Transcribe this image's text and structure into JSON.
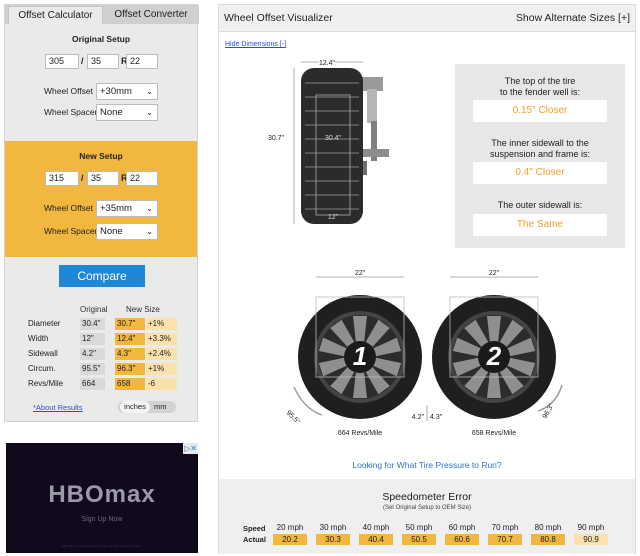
{
  "calculator": {
    "tabs": [
      "Offset Calculator",
      "Offset Converter"
    ],
    "original": {
      "title": "Original Setup",
      "width": "305",
      "sep1": "/",
      "ratio": "35",
      "sep2": "R",
      "rim": "22",
      "offset_label": "Wheel Offset",
      "offset_value": "+30mm",
      "spacer_label": "Wheel Spacer",
      "spacer_value": "None"
    },
    "new": {
      "title": "New Setup",
      "width": "315",
      "sep1": "/",
      "ratio": "35",
      "sep2": "R",
      "rim": "22",
      "offset_label": "Wheel Offset",
      "offset_value": "+35mm",
      "spacer_label": "Wheel Spacer",
      "spacer_value": "None"
    },
    "compare_label": "Compare",
    "comparison": {
      "headers": [
        "Original",
        "New Size"
      ],
      "rows": [
        {
          "label": "Diameter",
          "original": "30.4\"",
          "new": "30.7\"",
          "diff": "+1%"
        },
        {
          "label": "Width",
          "original": "12\"",
          "new": "12.4\"",
          "diff": "+3.3%"
        },
        {
          "label": "Sidewall",
          "original": "4.2\"",
          "new": "4.3\"",
          "diff": "+2.4%"
        },
        {
          "label": "Circum.",
          "original": "95.5\"",
          "new": "96.3\"",
          "diff": "+1%"
        },
        {
          "label": "Revs/Mile",
          "original": "664",
          "new": "658",
          "diff": "-6"
        }
      ]
    },
    "about_link": "*About Results",
    "units": [
      "inches",
      "mm"
    ]
  },
  "ad": {
    "choices": "▷✕",
    "brand": "HBOmax",
    "cta": "Sign Up Now",
    "fine_print": "HBO Max is only accessible in the US and certain territories."
  },
  "visualizer": {
    "title": "Wheel Offset Visualizer",
    "alt_sizes": "Show Alternate Sizes [+]",
    "hide_dimensions": "Hide Dimensions [-]",
    "tire_dims": {
      "width": "12.4\"",
      "height": "30.7\"",
      "inner": "30.4\"",
      "bottom": "12\""
    },
    "results": [
      {
        "question": "The top of the tire\nto the fender well is:",
        "answer": "0.15\" Closer"
      },
      {
        "question": "The inner sidewall to the\nsuspension and frame is:",
        "answer": "0.4\" Closer"
      },
      {
        "question": "The outer sidewall is:",
        "answer": "The Same"
      }
    ],
    "wheels": [
      {
        "num": "1",
        "width": "22\"",
        "circ": "95.5\"",
        "sidewall": "4.2\"",
        "revs": "664 Revs/Mile"
      },
      {
        "num": "2",
        "width": "22\"",
        "circ": "96.3\"",
        "sidewall": "4.3\"",
        "revs": "658 Revs/Mile"
      }
    ],
    "pressure_link": "Looking for What Tire Pressure to Run?",
    "speedometer": {
      "title": "Speedometer Error",
      "subtitle": "(Set Original Setup to OEM Size)",
      "speed_label": "Speed",
      "actual_label": "Actual",
      "speeds": [
        "20 mph",
        "30 mph",
        "40 mph",
        "50 mph",
        "60 mph",
        "70 mph",
        "80 mph",
        "90 mph"
      ],
      "actual": [
        "20.2",
        "30.3",
        "40.4",
        "50.5",
        "60.6",
        "70.7",
        "80.8",
        "90.9"
      ]
    }
  },
  "colors": {
    "accent": "#f2b73f",
    "button": "#1e87d8",
    "answer": "#f0a126",
    "link": "#2255cc"
  }
}
